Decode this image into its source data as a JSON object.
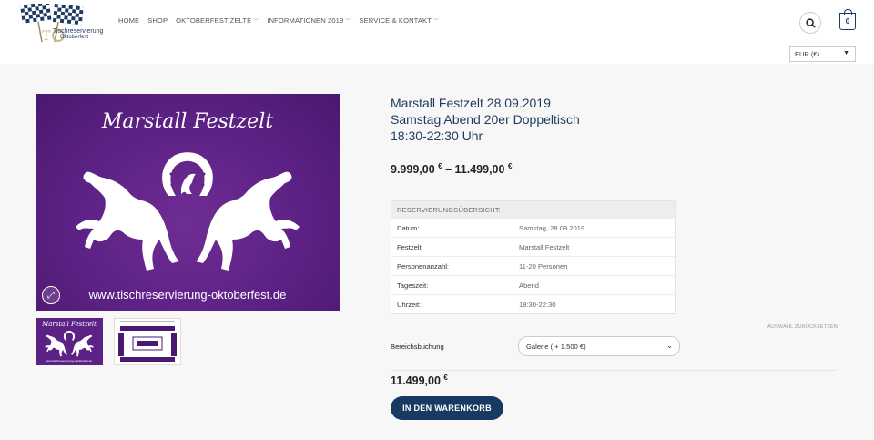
{
  "header": {
    "logo_line1": "Tischreservierung",
    "logo_line2": "Oktoberfest",
    "nav": [
      {
        "label": "HOME",
        "dropdown": false
      },
      {
        "label": "SHOP",
        "dropdown": false
      },
      {
        "label": "OKTOBERFEST ZELTE",
        "dropdown": true
      },
      {
        "label": "INFORMATIONEN 2019",
        "dropdown": true
      },
      {
        "label": "SERVICE & KONTAKT",
        "dropdown": true
      }
    ],
    "search_icon": "search-icon",
    "cart_count": "0"
  },
  "currency": {
    "selected": "EUR (€)"
  },
  "gallery": {
    "main_title": "Marstall Festzelt",
    "main_url": "www.tischreservierung-oktoberfest.de",
    "thumb1_title": "Marstall Festzelt",
    "thumb1_url": "www.tischreservierung-oktoberfest.de",
    "accent": "#5c2184"
  },
  "product": {
    "title_line1": "Marstall Festzelt 28.09.2019",
    "title_line2": "Samstag Abend 20er Doppeltisch",
    "title_line3": "18:30-22:30 Uhr",
    "price_from": "9.999,00",
    "price_to": "11.499,00",
    "currency_symbol": "€",
    "separator": "–"
  },
  "reservation": {
    "heading": "RESERVIERUNGSÜBERSICHT:",
    "rows": [
      {
        "label": "Datum:",
        "value": "Samstag, 28.09.2019"
      },
      {
        "label": "Festzelt:",
        "value": "Marstall Festzelt"
      },
      {
        "label": "Personenanzahl:",
        "value": "11-20 Personen"
      },
      {
        "label": "Tageszeit:",
        "value": "Abend"
      },
      {
        "label": "Uhrzeit:",
        "value": "18:30-22:30"
      }
    ]
  },
  "variation": {
    "reset_label": "AUSWAHL ZURÜCKSETZEN",
    "label": "Bereichsbuchung",
    "selected": "Galerie ( + 1.500 €)"
  },
  "selected_price": "11.499,00",
  "add_to_cart_label": "IN DEN WARENKORB",
  "colors": {
    "brand": "#173a63",
    "title": "#1e3a5f"
  }
}
